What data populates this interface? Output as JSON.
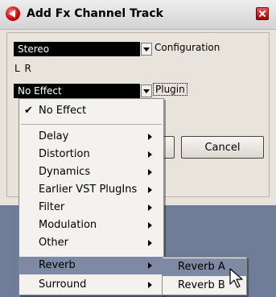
{
  "window": {
    "title": "Add Fx Channel Track"
  },
  "configuration": {
    "value": "Stereo",
    "label": "Configuration",
    "channels": "L R"
  },
  "plugin": {
    "value": "No Effect",
    "label": "Plugin"
  },
  "buttons": {
    "cancel": "Cancel"
  },
  "menu": {
    "no_effect": "No Effect",
    "items": [
      "Delay",
      "Distortion",
      "Dynamics",
      "Earlier VST PlugIns",
      "Filter",
      "Modulation",
      "Other",
      "Reverb",
      "Surround"
    ],
    "highlighted": "Reverb"
  },
  "submenu": {
    "items": [
      "Reverb A",
      "Reverb B"
    ],
    "highlighted": "Reverb A"
  },
  "colors": {
    "highlight": "#7e8aa3",
    "combo_bg": "#000000",
    "desktop": "#7d8aa3"
  },
  "icons": {
    "app": "cubase-icon",
    "close": "close-icon",
    "check": "checkmark-icon",
    "cursor": "mouse-pointer-icon"
  }
}
